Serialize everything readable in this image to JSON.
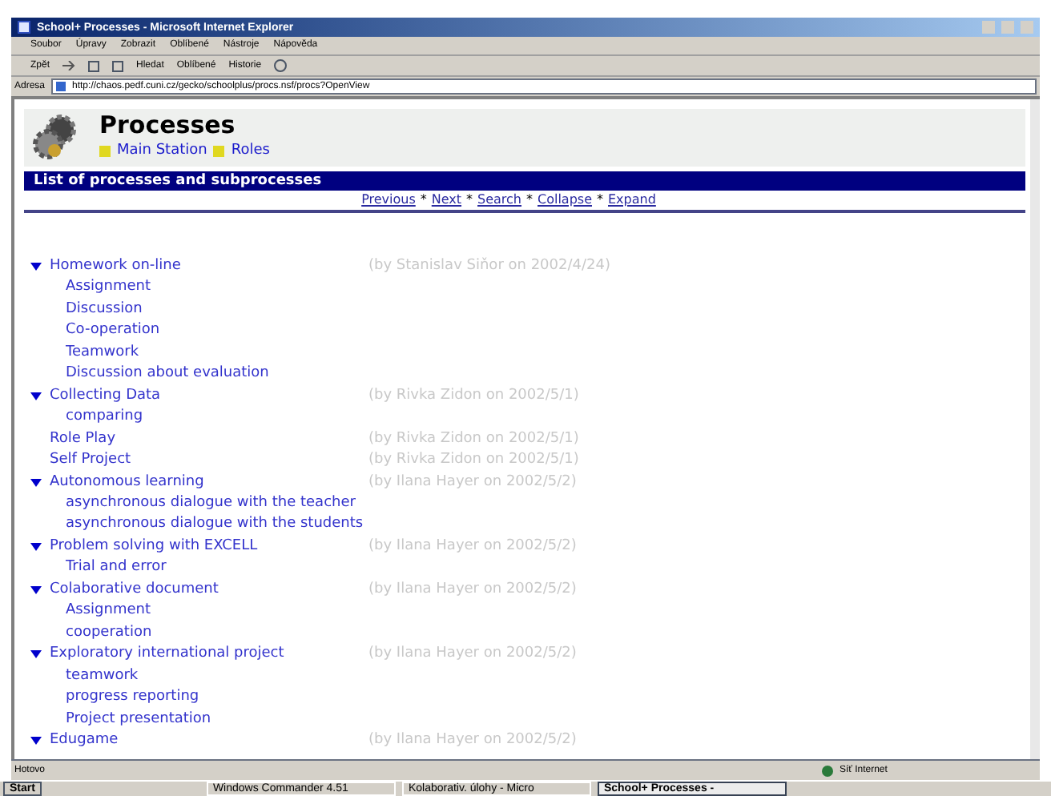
{
  "window": {
    "title": "School+ Processes - Microsoft Internet Explorer"
  },
  "menu": [
    "Soubor",
    "Úpravy",
    "Zobrazit",
    "Oblíbené",
    "Nástroje",
    "Nápověda"
  ],
  "toolbar": {
    "back": "Zpět",
    "search": "Hledat",
    "favorites": "Oblíbené",
    "history": "Historie"
  },
  "address": {
    "label": "Adresa",
    "value": "http://chaos.pedf.cuni.cz/gecko/schoolplus/procs.nsf/procs?OpenView"
  },
  "page": {
    "title": "Processes",
    "links": [
      "Main Station",
      "Roles"
    ],
    "section": "List of processes and subprocesses",
    "nav": [
      "Previous",
      "Next",
      "Search",
      "Collapse",
      "Expand"
    ],
    "nav_separator": "*"
  },
  "processes": [
    {
      "label": "Homework on-line",
      "expanded": true,
      "author": "(by Stanislav Siňor on 2002/4/24)",
      "children": [
        "Assignment",
        "Discussion",
        "Co-operation",
        "Teamwork",
        "Discussion about evaluation"
      ]
    },
    {
      "label": "Collecting Data",
      "expanded": true,
      "author": "(by Rivka Zidon on 2002/5/1)",
      "children": [
        "comparing"
      ]
    },
    {
      "label": "Role Play",
      "author": "(by Rivka Zidon on 2002/5/1)"
    },
    {
      "label": "Self Project",
      "author": "(by Rivka Zidon on 2002/5/1)"
    },
    {
      "label": "Autonomous learning",
      "expanded": true,
      "author": "(by Ilana Hayer on 2002/5/2)",
      "children": [
        "asynchronous dialogue with the teacher",
        "asynchronous dialogue with the students"
      ]
    },
    {
      "label": "Problem solving with EXCELL",
      "expanded": true,
      "author": "(by Ilana Hayer on 2002/5/2)",
      "children": [
        "Trial and error"
      ]
    },
    {
      "label": "Colaborative document",
      "expanded": true,
      "author": "(by Ilana Hayer on 2002/5/2)",
      "children": [
        "Assignment",
        "cooperation"
      ]
    },
    {
      "label": "Exploratory international project",
      "expanded": true,
      "author": "(by Ilana Hayer on 2002/5/2)",
      "children": [
        "teamwork",
        "progress reporting",
        "Project presentation"
      ]
    },
    {
      "label": "Edugame",
      "expanded": true,
      "author": "(by Ilana Hayer on 2002/5/2)"
    }
  ],
  "status_bar": {
    "text": "Hotovo",
    "zone": "Síť Internet"
  },
  "taskbar": {
    "start": "Start",
    "tasks": [
      {
        "label": "Windows Commander 4.51",
        "selected": false
      },
      {
        "label": "Kolaborativ. úlohy - Micro",
        "selected": false
      },
      {
        "label": "School+ Processes -",
        "selected": true
      }
    ]
  }
}
